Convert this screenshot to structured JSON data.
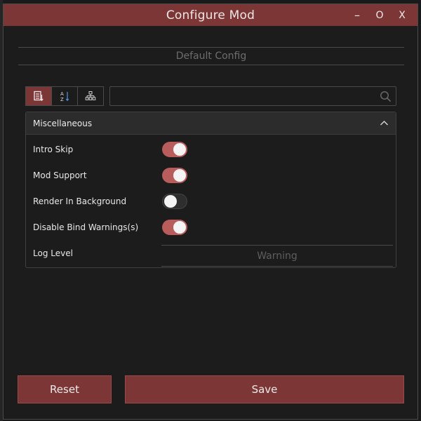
{
  "window": {
    "title": "Configure Mod",
    "controls": {
      "minimize": "–",
      "maximize": "O",
      "close": "X"
    }
  },
  "config_header": "Default Config",
  "toolbar": {
    "buttons": [
      {
        "icon": "sort-category-icon",
        "active": true
      },
      {
        "icon": "sort-alphabetical-icon",
        "active": false
      },
      {
        "icon": "hierarchy-icon",
        "active": false
      }
    ]
  },
  "search": {
    "value": "",
    "placeholder": ""
  },
  "section": {
    "title": "Miscellaneous",
    "settings": [
      {
        "label": "Intro Skip",
        "type": "toggle",
        "value": true
      },
      {
        "label": "Mod Support",
        "type": "toggle",
        "value": true
      },
      {
        "label": "Render In Background",
        "type": "toggle",
        "value": false
      },
      {
        "label": "Disable Bind Warnings(s)",
        "type": "toggle",
        "value": true
      },
      {
        "label": "Log Level",
        "type": "select",
        "value": "Warning"
      }
    ]
  },
  "actions": {
    "reset": "Reset",
    "save": "Save"
  },
  "colors": {
    "accent": "#7c3636",
    "toggle_on": "#b85c5c",
    "background": "#1c1c1c"
  }
}
